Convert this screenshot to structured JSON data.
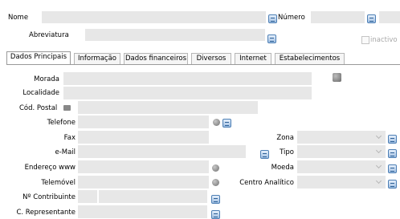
{
  "header": {
    "nome_label": "Nome",
    "numero_label": "Número",
    "abreviatura_label": "Abreviatura",
    "inactivo_label": "inactivo"
  },
  "tabs": [
    {
      "label": "Dados Principais",
      "active": true
    },
    {
      "label": "Informação",
      "active": false
    },
    {
      "label": "Dados financeiros",
      "active": false
    },
    {
      "label": "Diversos",
      "active": false
    },
    {
      "label": "Internet",
      "active": false
    },
    {
      "label": "Estabelecimentos",
      "active": false
    }
  ],
  "form": {
    "morada": "Morada",
    "localidade": "Localidade",
    "cod_postal": "Cód. Postal",
    "telefone": "Telefone",
    "fax": "Fax",
    "email": "e-Mail",
    "endereco_www": "Endereço www",
    "telemovel": "Telemóvel",
    "n_contribuinte": "Nº Contribuinte",
    "c_representante": "C. Representante",
    "zona": "Zona",
    "tipo": "Tipo",
    "moeda": "Moeda",
    "centro_analitico": "Centro Analítico"
  },
  "colors": {
    "field_bg": "#e7e7e7",
    "lookup_button_accent": "#4d7fb5"
  },
  "icons": [
    "search-lookup-icon",
    "dropdown-chevron-icon",
    "round-action-icon"
  ]
}
